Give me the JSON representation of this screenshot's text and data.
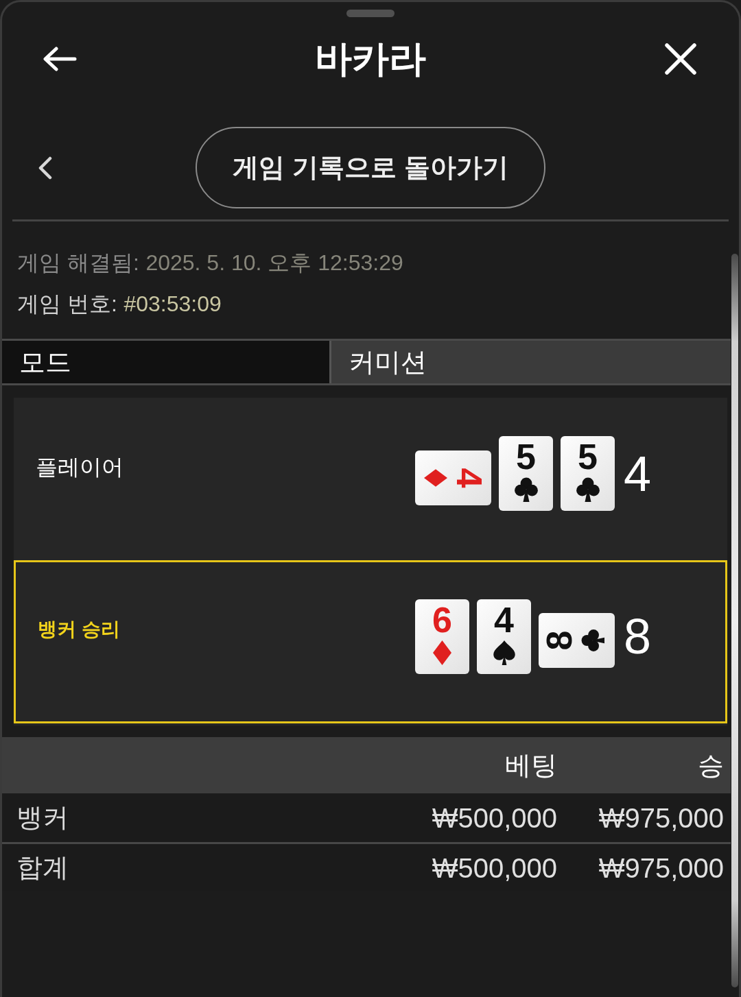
{
  "sheet": {
    "title": "바카라"
  },
  "navigation": {
    "back_link": "게임 기록으로 돌아가기"
  },
  "info": [
    {
      "label": "게임 해결됨:",
      "value": "2025. 5. 10. 오후 12:53:29"
    },
    {
      "label": "게임 번호:",
      "value": "#03:53:09"
    }
  ],
  "mode": {
    "label": "모드",
    "value": "커미션"
  },
  "hands": [
    {
      "label": "플레이어",
      "winner": false,
      "cards": [
        {
          "rank": "4",
          "kind": "diamonds",
          "rotated": true,
          "clockwise": true
        },
        {
          "rank": "5",
          "kind": "clubs",
          "rotated": false
        },
        {
          "rank": "5",
          "kind": "clubs",
          "rotated": false
        }
      ],
      "score": "4"
    },
    {
      "label": "뱅커 승리",
      "winner": true,
      "cards": [
        {
          "rank": "6",
          "kind": "diamonds",
          "rotated": false
        },
        {
          "rank": "4",
          "kind": "spades",
          "rotated": false
        },
        {
          "rank": "8",
          "kind": "clubs",
          "rotated": true,
          "clockwise": false
        }
      ],
      "score": "8"
    }
  ],
  "bets_table": {
    "columns": [
      "베팅",
      "승"
    ],
    "rows": [
      {
        "label": "뱅커",
        "cells": [
          "₩500,000",
          "₩975,000"
        ]
      },
      {
        "label": "합계",
        "cells": [
          "₩500,000",
          "₩975,000"
        ]
      }
    ]
  }
}
